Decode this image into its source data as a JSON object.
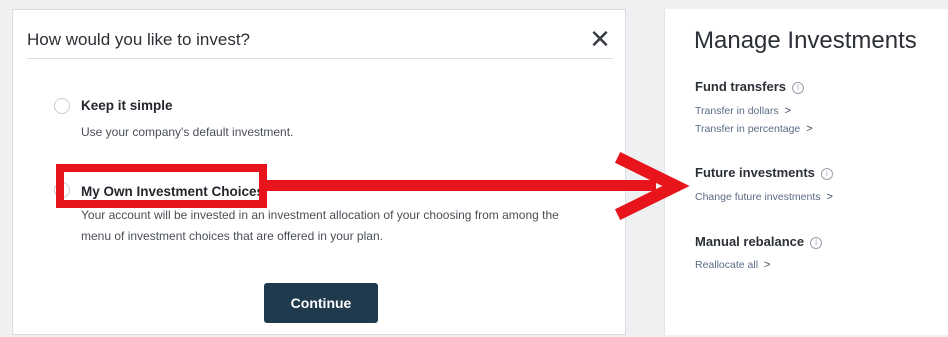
{
  "dialog": {
    "title": "How would you like to invest?",
    "close_label": "✕",
    "option_simple": {
      "title": "Keep it simple",
      "description": "Use your company's default investment."
    },
    "option_own": {
      "title": "My Own Investment Choices",
      "description_line1": "Your account will be invested in an investment allocation of your choosing from among the",
      "description_line2": "menu of investment choices that are offered in your plan."
    },
    "continue_label": "Continue"
  },
  "panel": {
    "title": "Manage Investments",
    "info_glyph": "i",
    "chevron": ">",
    "fund_transfers": {
      "heading": "Fund transfers",
      "links": [
        "Transfer in dollars",
        "Transfer in percentage"
      ]
    },
    "future_investments": {
      "heading": "Future investments",
      "links": [
        "Change future investments"
      ]
    },
    "manual_rebalance": {
      "heading": "Manual rebalance",
      "links": [
        "Reallocate all"
      ]
    }
  },
  "annotation": {
    "color": "#e8141b"
  }
}
